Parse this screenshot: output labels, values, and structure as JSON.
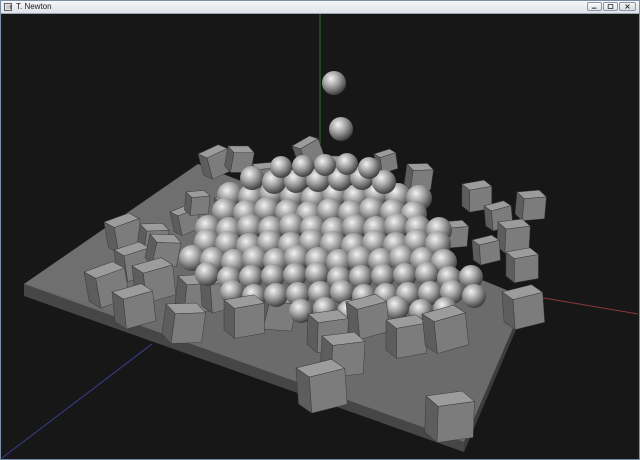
{
  "window": {
    "title": "T. Newton",
    "app_icon": "app-window-icon",
    "controls": [
      "minimize-icon",
      "maximize-icon",
      "close-icon"
    ]
  },
  "scene": {
    "background_color": "#171717",
    "platform_top_color": "#6b6b6b",
    "platform_side_color": "#4a4a4a",
    "axis_colors": {
      "x": "#8a3a3a",
      "y": "#2f6f3a",
      "z": "#3a3f8f"
    }
  }
}
